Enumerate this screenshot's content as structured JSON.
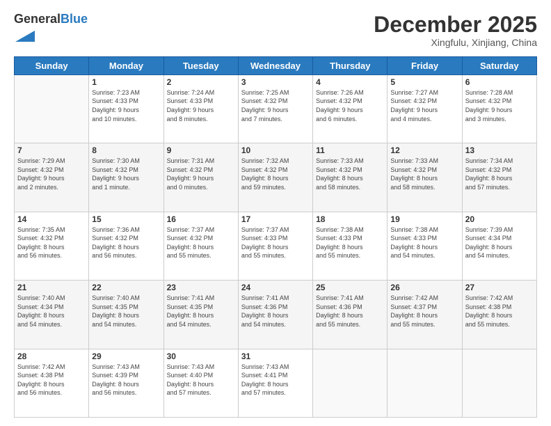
{
  "logo": {
    "general": "General",
    "blue": "Blue"
  },
  "header": {
    "month": "December 2025",
    "location": "Xingfulu, Xinjiang, China"
  },
  "days_of_week": [
    "Sunday",
    "Monday",
    "Tuesday",
    "Wednesday",
    "Thursday",
    "Friday",
    "Saturday"
  ],
  "weeks": [
    [
      {
        "day": "",
        "info": ""
      },
      {
        "day": "1",
        "info": "Sunrise: 7:23 AM\nSunset: 4:33 PM\nDaylight: 9 hours\nand 10 minutes."
      },
      {
        "day": "2",
        "info": "Sunrise: 7:24 AM\nSunset: 4:33 PM\nDaylight: 9 hours\nand 8 minutes."
      },
      {
        "day": "3",
        "info": "Sunrise: 7:25 AM\nSunset: 4:32 PM\nDaylight: 9 hours\nand 7 minutes."
      },
      {
        "day": "4",
        "info": "Sunrise: 7:26 AM\nSunset: 4:32 PM\nDaylight: 9 hours\nand 6 minutes."
      },
      {
        "day": "5",
        "info": "Sunrise: 7:27 AM\nSunset: 4:32 PM\nDaylight: 9 hours\nand 4 minutes."
      },
      {
        "day": "6",
        "info": "Sunrise: 7:28 AM\nSunset: 4:32 PM\nDaylight: 9 hours\nand 3 minutes."
      }
    ],
    [
      {
        "day": "7",
        "info": "Sunrise: 7:29 AM\nSunset: 4:32 PM\nDaylight: 9 hours\nand 2 minutes."
      },
      {
        "day": "8",
        "info": "Sunrise: 7:30 AM\nSunset: 4:32 PM\nDaylight: 9 hours\nand 1 minute."
      },
      {
        "day": "9",
        "info": "Sunrise: 7:31 AM\nSunset: 4:32 PM\nDaylight: 9 hours\nand 0 minutes."
      },
      {
        "day": "10",
        "info": "Sunrise: 7:32 AM\nSunset: 4:32 PM\nDaylight: 8 hours\nand 59 minutes."
      },
      {
        "day": "11",
        "info": "Sunrise: 7:33 AM\nSunset: 4:32 PM\nDaylight: 8 hours\nand 58 minutes."
      },
      {
        "day": "12",
        "info": "Sunrise: 7:33 AM\nSunset: 4:32 PM\nDaylight: 8 hours\nand 58 minutes."
      },
      {
        "day": "13",
        "info": "Sunrise: 7:34 AM\nSunset: 4:32 PM\nDaylight: 8 hours\nand 57 minutes."
      }
    ],
    [
      {
        "day": "14",
        "info": "Sunrise: 7:35 AM\nSunset: 4:32 PM\nDaylight: 8 hours\nand 56 minutes."
      },
      {
        "day": "15",
        "info": "Sunrise: 7:36 AM\nSunset: 4:32 PM\nDaylight: 8 hours\nand 56 minutes."
      },
      {
        "day": "16",
        "info": "Sunrise: 7:37 AM\nSunset: 4:32 PM\nDaylight: 8 hours\nand 55 minutes."
      },
      {
        "day": "17",
        "info": "Sunrise: 7:37 AM\nSunset: 4:33 PM\nDaylight: 8 hours\nand 55 minutes."
      },
      {
        "day": "18",
        "info": "Sunrise: 7:38 AM\nSunset: 4:33 PM\nDaylight: 8 hours\nand 55 minutes."
      },
      {
        "day": "19",
        "info": "Sunrise: 7:38 AM\nSunset: 4:33 PM\nDaylight: 8 hours\nand 54 minutes."
      },
      {
        "day": "20",
        "info": "Sunrise: 7:39 AM\nSunset: 4:34 PM\nDaylight: 8 hours\nand 54 minutes."
      }
    ],
    [
      {
        "day": "21",
        "info": "Sunrise: 7:40 AM\nSunset: 4:34 PM\nDaylight: 8 hours\nand 54 minutes."
      },
      {
        "day": "22",
        "info": "Sunrise: 7:40 AM\nSunset: 4:35 PM\nDaylight: 8 hours\nand 54 minutes."
      },
      {
        "day": "23",
        "info": "Sunrise: 7:41 AM\nSunset: 4:35 PM\nDaylight: 8 hours\nand 54 minutes."
      },
      {
        "day": "24",
        "info": "Sunrise: 7:41 AM\nSunset: 4:36 PM\nDaylight: 8 hours\nand 54 minutes."
      },
      {
        "day": "25",
        "info": "Sunrise: 7:41 AM\nSunset: 4:36 PM\nDaylight: 8 hours\nand 55 minutes."
      },
      {
        "day": "26",
        "info": "Sunrise: 7:42 AM\nSunset: 4:37 PM\nDaylight: 8 hours\nand 55 minutes."
      },
      {
        "day": "27",
        "info": "Sunrise: 7:42 AM\nSunset: 4:38 PM\nDaylight: 8 hours\nand 55 minutes."
      }
    ],
    [
      {
        "day": "28",
        "info": "Sunrise: 7:42 AM\nSunset: 4:38 PM\nDaylight: 8 hours\nand 56 minutes."
      },
      {
        "day": "29",
        "info": "Sunrise: 7:43 AM\nSunset: 4:39 PM\nDaylight: 8 hours\nand 56 minutes."
      },
      {
        "day": "30",
        "info": "Sunrise: 7:43 AM\nSunset: 4:40 PM\nDaylight: 8 hours\nand 57 minutes."
      },
      {
        "day": "31",
        "info": "Sunrise: 7:43 AM\nSunset: 4:41 PM\nDaylight: 8 hours\nand 57 minutes."
      },
      {
        "day": "",
        "info": ""
      },
      {
        "day": "",
        "info": ""
      },
      {
        "day": "",
        "info": ""
      }
    ]
  ]
}
